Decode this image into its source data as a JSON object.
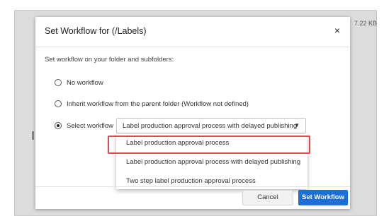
{
  "background": {
    "file_size": "7.22 KB"
  },
  "dialog": {
    "title": "Set Workflow for (/Labels)",
    "close_label": "×",
    "intro": "Set workflow on your folder and subfolders:",
    "options": [
      {
        "label": "No workflow",
        "checked": false
      },
      {
        "label": "Inherit workflow from the parent folder (Workflow not defined)",
        "checked": false
      },
      {
        "label": "Select workflow",
        "checked": true
      }
    ],
    "select": {
      "value": "Label production approval process with delayed publishing",
      "caret": "▼"
    },
    "dropdown_items": [
      "Label production approval process",
      "Label production approval process with delayed publishing",
      "Two step label production approval process"
    ],
    "highlighted_item_index": 1,
    "cancel_label": "Cancel",
    "submit_label": "Set Workflow"
  },
  "colors": {
    "primary": "#1c6fd6",
    "highlight_border": "#e0474c",
    "overlay": "#dcdcdc"
  }
}
